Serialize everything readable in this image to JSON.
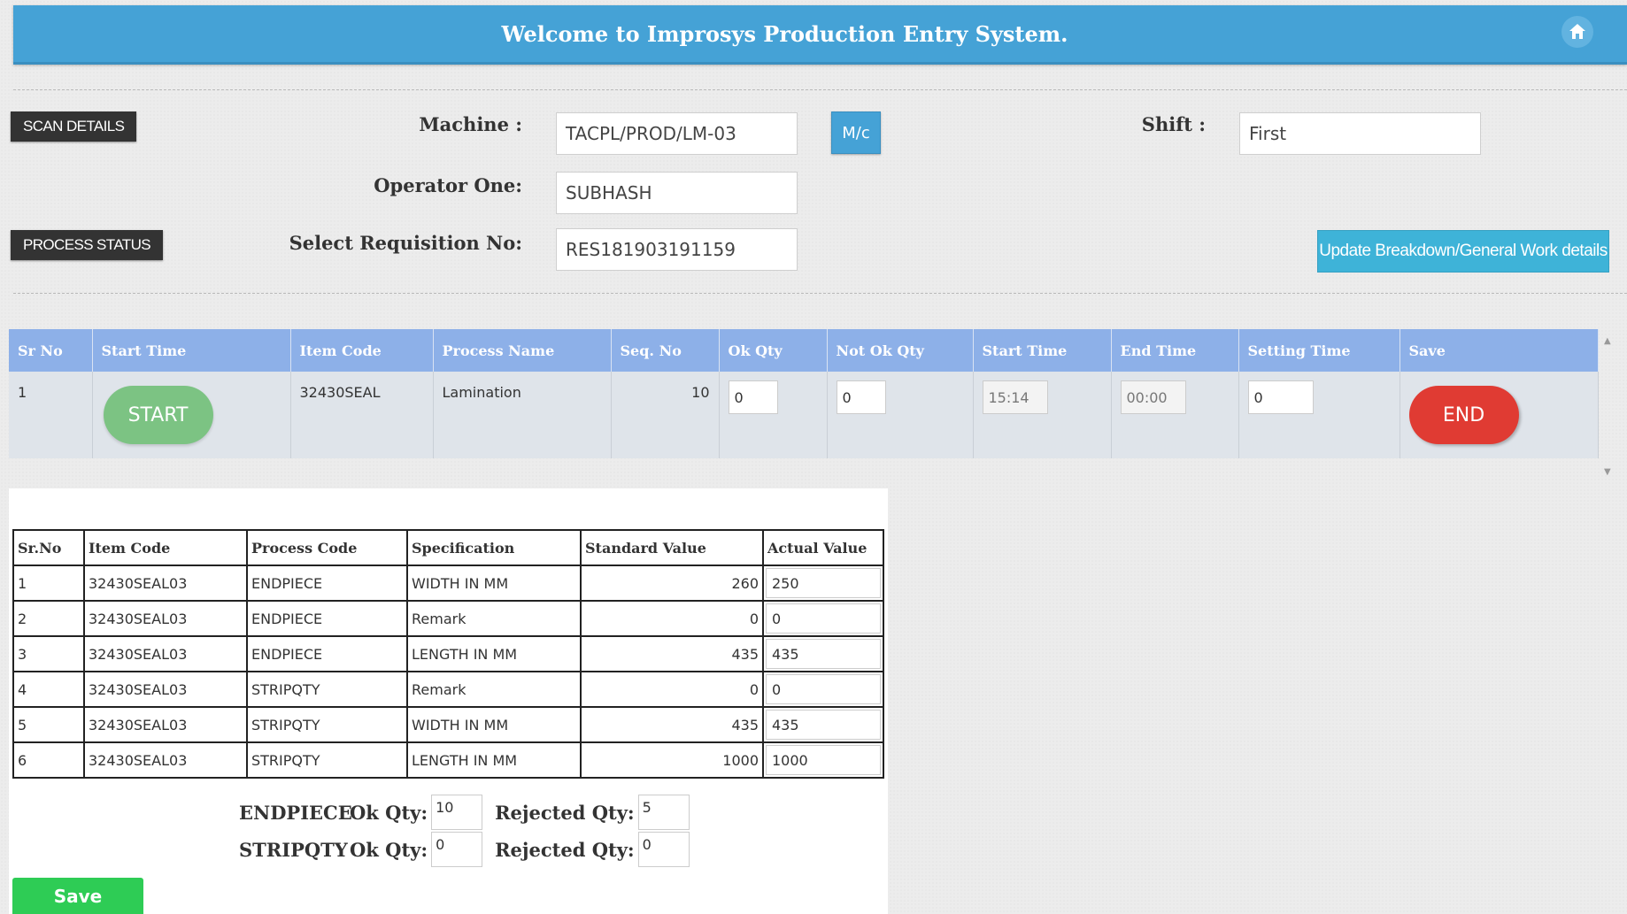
{
  "header": {
    "title": "Welcome to Improsys Production Entry System."
  },
  "icons": {
    "home": "home-icon"
  },
  "buttons": {
    "scan_details": "SCAN DETAILS",
    "process_status": "PROCESS STATUS",
    "mc": "M/c",
    "update": "Update Breakdown/General Work details",
    "save": "Save"
  },
  "form": {
    "machine_label": "Machine :",
    "machine_value": "TACPL/PROD/LM-03",
    "shift_label": "Shift :",
    "shift_value": "First",
    "operator_label": "Operator One:",
    "operator_value": "SUBHASH",
    "requisition_label": "Select Requisition No:",
    "requisition_value": "RES181903191159"
  },
  "process_grid": {
    "headers": [
      "Sr No",
      "Start Time",
      "Item Code",
      "Process Name",
      "Seq. No",
      "Ok Qty",
      "Not Ok Qty",
      "Start Time",
      "End Time",
      "Setting Time",
      "Save"
    ],
    "row": {
      "sr": "1",
      "start_btn": "START",
      "item_code": "32430SEAL",
      "process_name": "Lamination",
      "seq": "10",
      "ok_qty": "0",
      "not_ok_qty": "0",
      "start_time": "15:14",
      "end_time": "00:00",
      "setting_time": "0",
      "end_btn": "END"
    }
  },
  "spec_table": {
    "headers": [
      "Sr.No",
      "Item Code",
      "Process Code",
      "Specification",
      "Standard Value",
      "Actual Value"
    ],
    "rows": [
      {
        "sr": "1",
        "item": "32430SEAL03",
        "process": "ENDPIECE",
        "spec": "WIDTH IN MM",
        "std": "260",
        "actual": "250"
      },
      {
        "sr": "2",
        "item": "32430SEAL03",
        "process": "ENDPIECE",
        "spec": "Remark",
        "std": "0",
        "actual": "0"
      },
      {
        "sr": "3",
        "item": "32430SEAL03",
        "process": "ENDPIECE",
        "spec": "LENGTH IN MM",
        "std": "435",
        "actual": "435"
      },
      {
        "sr": "4",
        "item": "32430SEAL03",
        "process": "STRIPQTY",
        "spec": "Remark",
        "std": "0",
        "actual": "0"
      },
      {
        "sr": "5",
        "item": "32430SEAL03",
        "process": "STRIPQTY",
        "spec": "WIDTH IN MM",
        "std": "435",
        "actual": "435"
      },
      {
        "sr": "6",
        "item": "32430SEAL03",
        "process": "STRIPQTY",
        "spec": "LENGTH IN MM",
        "std": "1000",
        "actual": "1000"
      }
    ]
  },
  "summary": {
    "ok_label": "Ok Qty:",
    "rejected_label": "Rejected Qty:",
    "rows": [
      {
        "name": "ENDPIECE",
        "ok": "10",
        "rejected": "5"
      },
      {
        "name": "STRIPQTY",
        "ok": "0",
        "rejected": "0"
      }
    ]
  }
}
